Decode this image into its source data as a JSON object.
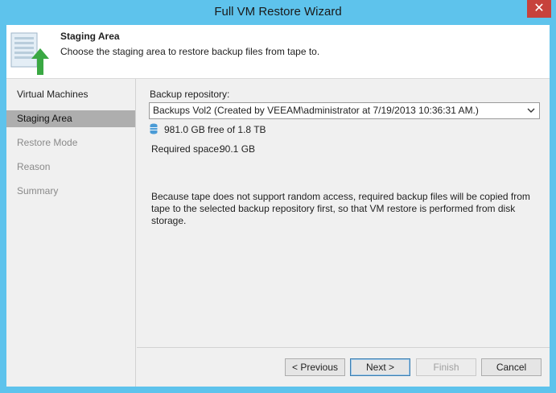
{
  "window": {
    "title": "Full VM Restore Wizard",
    "close_label": "✕"
  },
  "header": {
    "title": "Staging Area",
    "description": "Choose the staging area to restore backup files from tape to."
  },
  "steps": [
    {
      "label": "Virtual Machines",
      "state": "done"
    },
    {
      "label": "Staging Area",
      "state": "active"
    },
    {
      "label": "Restore Mode",
      "state": "future"
    },
    {
      "label": "Reason",
      "state": "future"
    },
    {
      "label": "Summary",
      "state": "future"
    }
  ],
  "main": {
    "repo_label": "Backup repository:",
    "repo_value": "Backups Vol2 (Created by VEEAM\\administrator at 7/19/2013 10:36:31 AM.)",
    "free_space": "981.0 GB free of 1.8 TB",
    "required_label": "Required space:",
    "required_value": "90.1 GB",
    "description": "Because tape does not support random access, required backup files will be copied from tape to the selected backup repository first, so that VM restore is performed from disk storage."
  },
  "buttons": {
    "previous": "< Previous",
    "next": "Next >",
    "finish": "Finish",
    "cancel": "Cancel"
  },
  "colors": {
    "titlebar": "#5ec3ec",
    "close": "#c7423c",
    "active_step": "#aeaeae",
    "arrow": "#3aa843"
  }
}
